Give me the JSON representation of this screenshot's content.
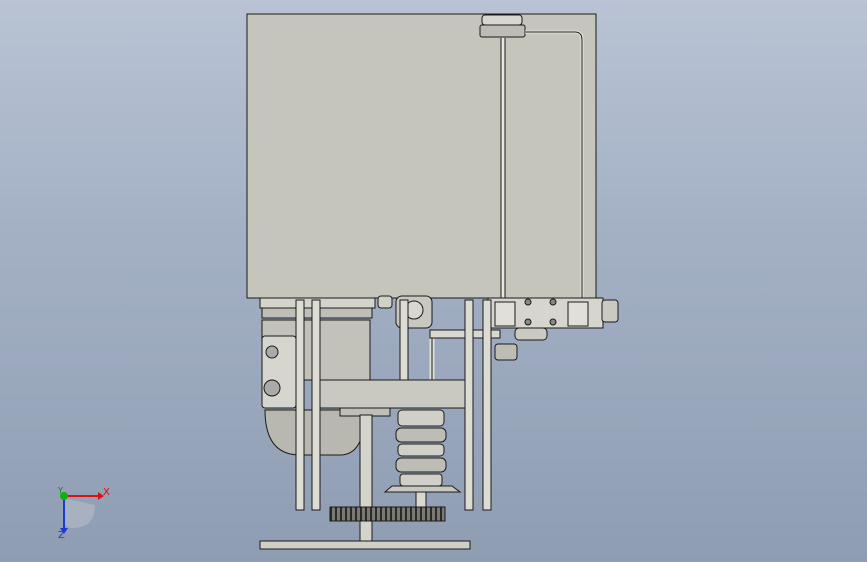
{
  "viewport": {
    "background_top": "#b9c3d4",
    "background_bottom": "#8f9db3"
  },
  "model": {
    "panel_color": "#c8c8c0",
    "part_color": "#d4d4cc",
    "edge_color": "#1a1a1a"
  },
  "triad": {
    "x_label": "X",
    "y_label": "Y",
    "z_label": "Z",
    "x_color": "#e01010",
    "y_color": "#10b010",
    "z_color": "#1a3ad0"
  }
}
